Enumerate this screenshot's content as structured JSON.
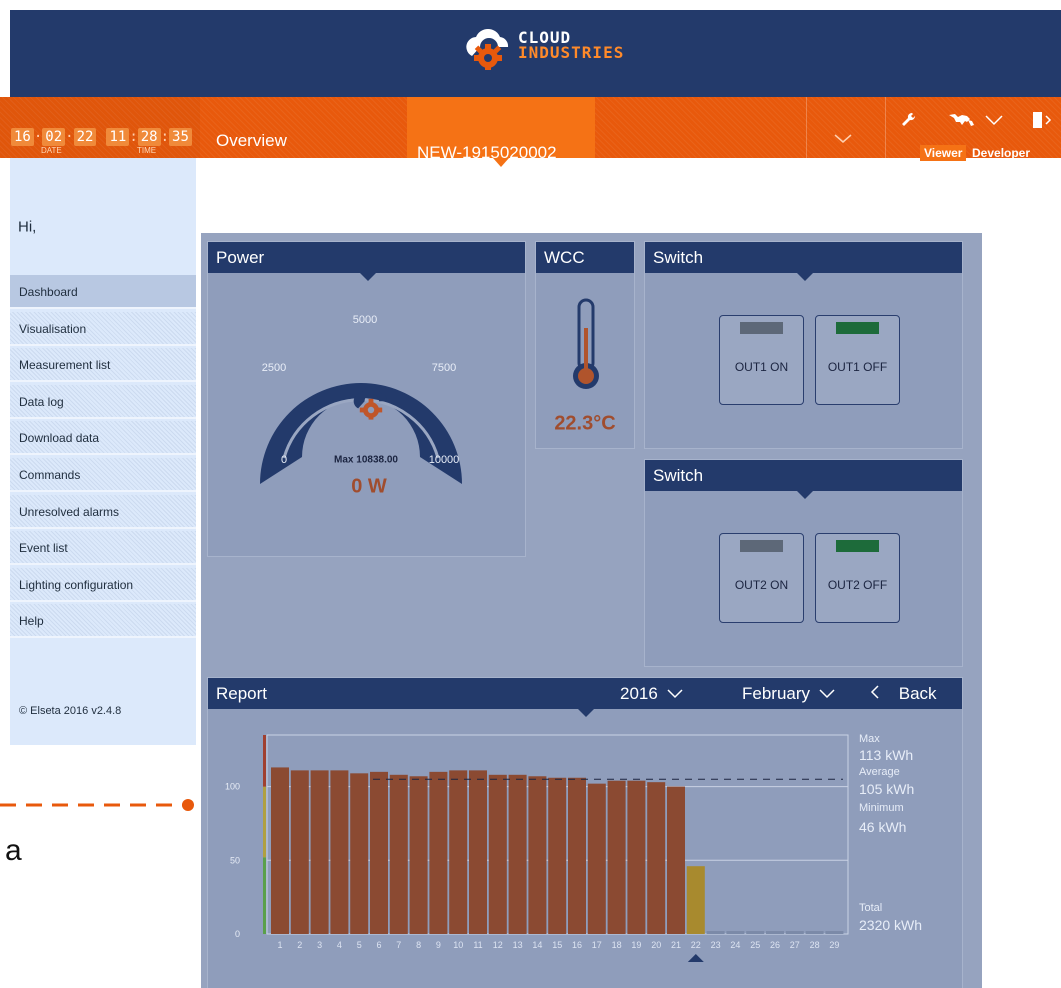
{
  "brand": {
    "line1": "CLOUD",
    "line2": "INDUSTRIES"
  },
  "clock": {
    "d1": "16",
    "d2": "02",
    "d3": "22",
    "t1": "11",
    "t2": "28",
    "t3": "35",
    "date_label": "DATE",
    "time_label": "TIME"
  },
  "tabs": {
    "overview": "Overview",
    "device": "NEW-1915020002"
  },
  "roles": {
    "viewer": "Viewer",
    "developer": "Developer"
  },
  "sidebar": {
    "greeting": "Hi,",
    "items": [
      {
        "label": "Dashboard"
      },
      {
        "label": "Visualisation"
      },
      {
        "label": "Measurement list"
      },
      {
        "label": "Data log"
      },
      {
        "label": "Download data"
      },
      {
        "label": "Commands"
      },
      {
        "label": "Unresolved alarms"
      },
      {
        "label": "Event list"
      },
      {
        "label": "Lighting configuration"
      },
      {
        "label": "Help"
      }
    ],
    "footer": "© Elseta 2016 v2.4.8"
  },
  "power": {
    "title": "Power",
    "ticks": [
      "0",
      "2500",
      "5000",
      "7500",
      "10000"
    ],
    "max_label": "Max",
    "max_value": "10838.00",
    "value": "0 W"
  },
  "wcc": {
    "title": "WCC",
    "value": "22.3°C"
  },
  "switch1": {
    "title": "Switch",
    "on_label": "OUT1 ON",
    "off_label": "OUT1 OFF"
  },
  "switch2": {
    "title": "Switch",
    "on_label": "OUT2 ON",
    "off_label": "OUT2 OFF"
  },
  "report": {
    "title": "Report",
    "year": "2016",
    "month": "February",
    "back": "Back",
    "max_label": "Max",
    "max_value": "113 kWh",
    "avg_label": "Average",
    "avg_value": "105 kWh",
    "min_label": "Minimum",
    "min_value": "46 kWh",
    "total_label": "Total",
    "total_value": "2320 kWh"
  },
  "annotation": {
    "letter": "a"
  },
  "colors": {
    "nav": "#233a6b",
    "accent": "#e8590c",
    "bar": "#8b4a32",
    "bar_partial": "#a88a2e",
    "value_text": "#a04d2e"
  },
  "icons": [
    "cloud-gear-logo",
    "wrench-icon",
    "world-map-icon",
    "chevron-down-icon",
    "logout-door-icon",
    "thermometer-icon"
  ],
  "chart_data": {
    "type": "bar",
    "categories": [
      "1",
      "2",
      "3",
      "4",
      "5",
      "6",
      "7",
      "8",
      "9",
      "10",
      "11",
      "12",
      "13",
      "14",
      "15",
      "16",
      "17",
      "18",
      "19",
      "20",
      "21",
      "22",
      "23",
      "24",
      "25",
      "26",
      "27",
      "28",
      "29"
    ],
    "values": [
      113,
      111,
      111,
      111,
      109,
      110,
      108,
      107,
      110,
      111,
      111,
      108,
      108,
      107,
      106,
      106,
      102,
      104,
      104,
      103,
      100,
      46,
      2,
      2,
      2,
      2,
      2,
      2,
      2
    ],
    "yticks": [
      "0",
      "50",
      "100"
    ],
    "ylim": [
      0,
      135
    ],
    "average": 105
  }
}
